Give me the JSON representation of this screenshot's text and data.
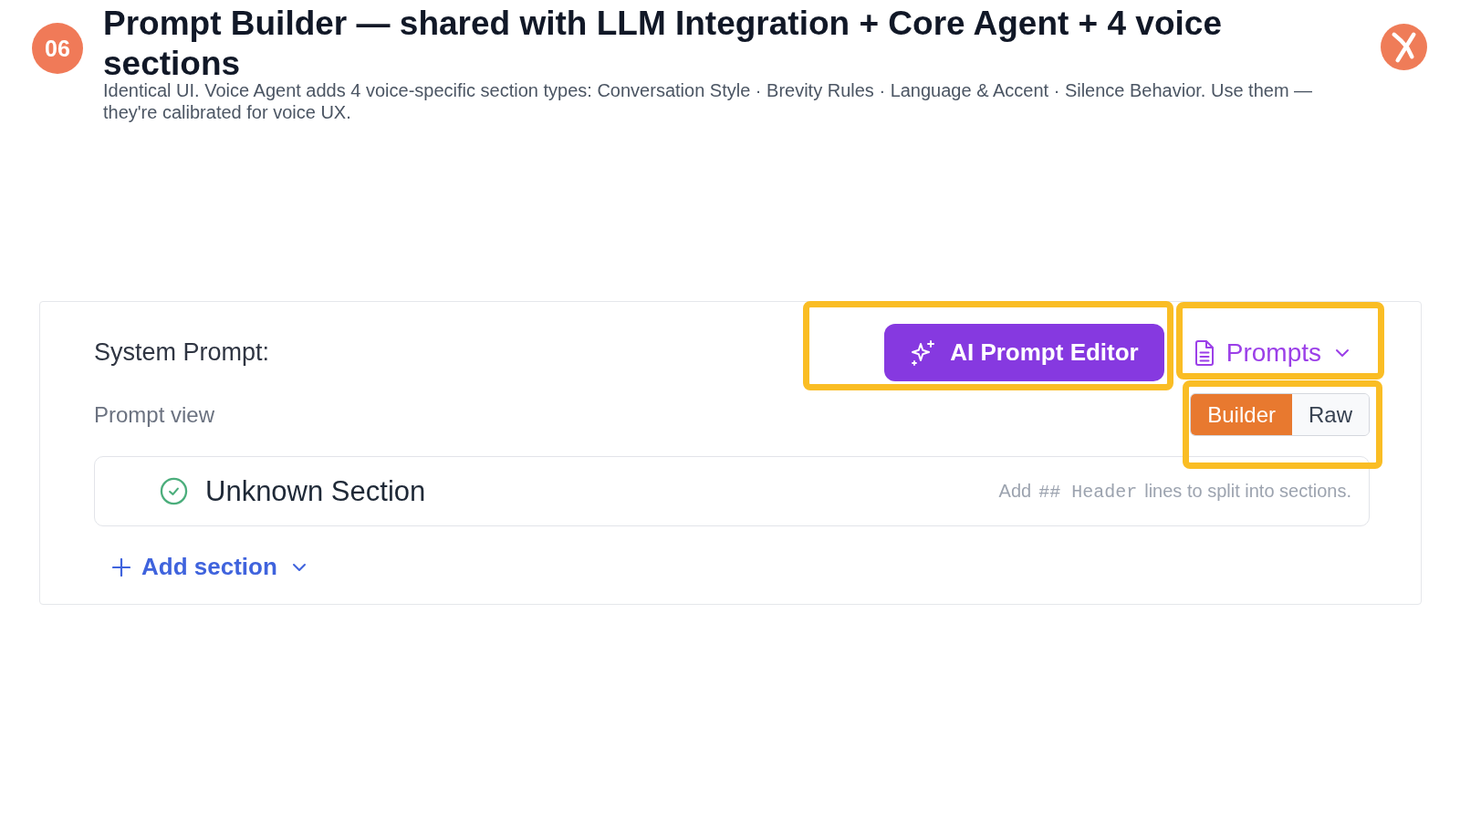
{
  "header": {
    "step": "06",
    "title": "Prompt Builder — shared with LLM Integration + Core Agent + 4 voice sections",
    "subtitle": "Identical UI. Voice Agent adds 4 voice-specific section types: Conversation Style · Brevity Rules · Language & Accent · Silence Behavior. Use them — they're calibrated for voice UX."
  },
  "system_prompt": {
    "label": "System Prompt:",
    "ai_editor_button": {
      "label": "AI Prompt Editor",
      "highlighted": true
    },
    "prompts_menu": {
      "label": "Prompts",
      "highlighted": true
    },
    "view": {
      "label": "Prompt view",
      "highlighted": true,
      "options": [
        {
          "label": "Builder",
          "selected": true
        },
        {
          "label": "Raw",
          "selected": false
        }
      ]
    },
    "sections": [
      {
        "title": "Unknown Section",
        "complete": true,
        "hint": [
          {
            "kind": "text",
            "text": "Add"
          },
          {
            "kind": "code",
            "text": "## Header"
          },
          {
            "kind": "text",
            "text": "lines to split into sections."
          }
        ]
      }
    ],
    "add_section": {
      "label": "Add section"
    }
  }
}
